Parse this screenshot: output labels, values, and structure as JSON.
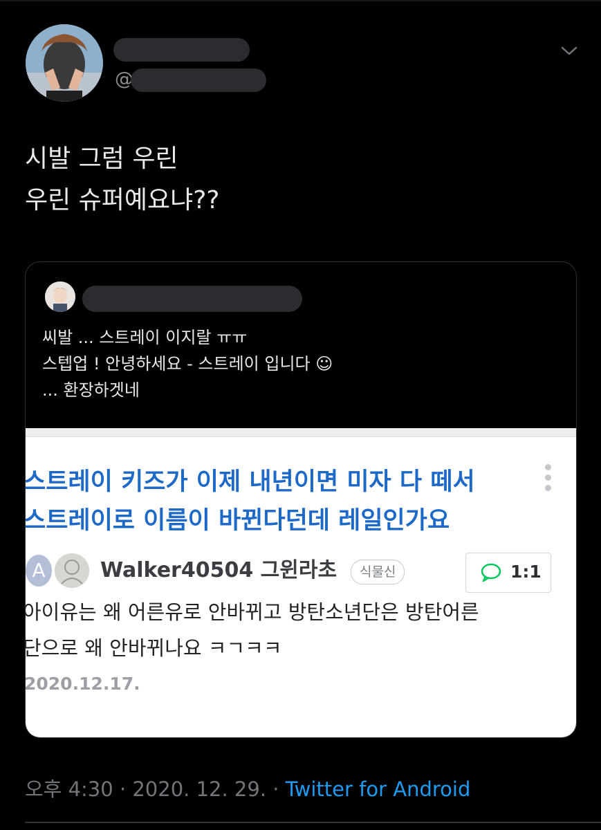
{
  "tweet": {
    "handle_prefix": "@",
    "text_lines": [
      "시발 그럼 우린",
      "우린 슈퍼예요냐??"
    ],
    "meta": {
      "time": "오후 4:30",
      "separator": " · ",
      "date": "2020. 12. 29.",
      "source": "Twitter for Android"
    }
  },
  "quote": {
    "text_lines": [
      "씨발 ... 스트레이 이지랄 ㅠㅠ",
      "스텝업 ! 안녕하세요 - 스트레이 입니다 ☺",
      "... 환장하겟네"
    ],
    "screenshot": {
      "title_lines": [
        "스트레이 키즈가 이제 내년이면 미자 다 떼서",
        "스트레이로 이름이 바뀐다던데 레일인가요"
      ],
      "avatar_letter": "A",
      "author": "Walker40504 그윈라초",
      "grade": "식물신",
      "chat_label": "1:1",
      "body_lines": [
        "아이유는 왜 어른유로 안바뀌고 방탄소년단은 방탄어른",
        "단으로 왜 안바뀌나요 ㅋㄱㅋㅋ"
      ],
      "date": "2020.12.17."
    }
  },
  "colors": {
    "background": "#000000",
    "text": "#e7e9ea",
    "muted": "#71767b",
    "link": "#1d9bf0",
    "naver_title": "#1d69c7",
    "chat_green": "#03c75a"
  },
  "icons": [
    "chevron-down-icon",
    "kebab-menu-icon",
    "chat-bubble-icon"
  ]
}
